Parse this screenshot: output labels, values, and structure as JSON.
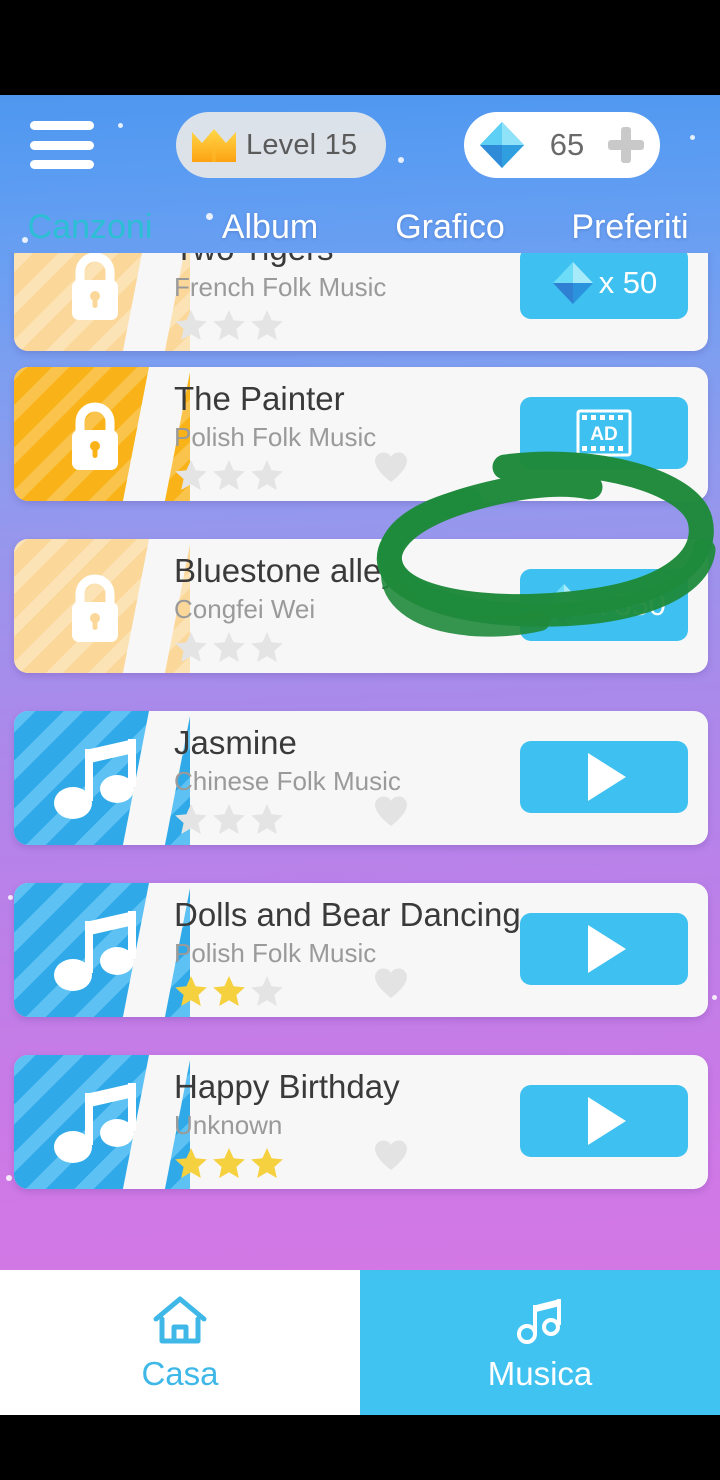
{
  "header": {
    "menu_icon": "hamburger-menu-icon",
    "level_badge": {
      "icon": "crown-icon",
      "label": "Level 15"
    },
    "gem_badge": {
      "icon": "diamond-gem-icon",
      "count": "65",
      "add_icon": "plus-icon"
    }
  },
  "tabs": [
    {
      "label": "Canzoni",
      "active": true
    },
    {
      "label": "Album",
      "active": false
    },
    {
      "label": "Grafico",
      "active": false
    },
    {
      "label": "Preferiti",
      "active": false
    }
  ],
  "songs": [
    {
      "title": "Two Tigers",
      "artist": "French Folk Music",
      "locked": true,
      "thumb_style": "pale-orange",
      "stars_filled": 0,
      "stars_total": 3,
      "action_type": "price",
      "action_label": "x 50",
      "favorite": false
    },
    {
      "title": "The Painter",
      "artist": "Polish Folk Music",
      "locked": true,
      "thumb_style": "bright-orange",
      "stars_filled": 0,
      "stars_total": 3,
      "action_type": "ad",
      "action_label": "AD",
      "favorite": false
    },
    {
      "title": "Bluestone alley",
      "artist": "Congfei Wei",
      "locked": true,
      "thumb_style": "pale-orange",
      "stars_filled": 0,
      "stars_total": 3,
      "action_type": "price",
      "action_label": "x 350",
      "favorite": false
    },
    {
      "title": "Jasmine",
      "artist": "Chinese Folk Music",
      "locked": false,
      "thumb_style": "blue",
      "stars_filled": 0,
      "stars_total": 3,
      "action_type": "play",
      "action_label": "",
      "favorite": false
    },
    {
      "title": "Dolls and Bear Dancing",
      "artist": "Polish Folk Music",
      "locked": false,
      "thumb_style": "blue",
      "stars_filled": 2,
      "stars_total": 3,
      "action_type": "play",
      "action_label": "",
      "favorite": false
    },
    {
      "title": "Happy Birthday",
      "artist": "Unknown",
      "locked": false,
      "thumb_style": "blue",
      "stars_filled": 3,
      "stars_total": 3,
      "action_type": "play",
      "action_label": "",
      "favorite": false
    }
  ],
  "annotation": {
    "type": "hand-drawn-ellipse-highlight",
    "color": "#1f8a3b",
    "target": "The Painter AD button"
  },
  "bottom_nav": [
    {
      "label": "Casa",
      "icon": "home-icon",
      "active": false
    },
    {
      "label": "Musica",
      "icon": "music-note-icon",
      "active": true
    }
  ],
  "colors": {
    "accent_blue": "#3ec0f0",
    "active_tab": "#2bbfd4",
    "star_gold": "#f5d03f",
    "star_empty": "#e2e2e2",
    "lock_orange": "#f9b319",
    "lock_pale": "#fbd89a",
    "annotation_green": "#1f8a3b"
  }
}
